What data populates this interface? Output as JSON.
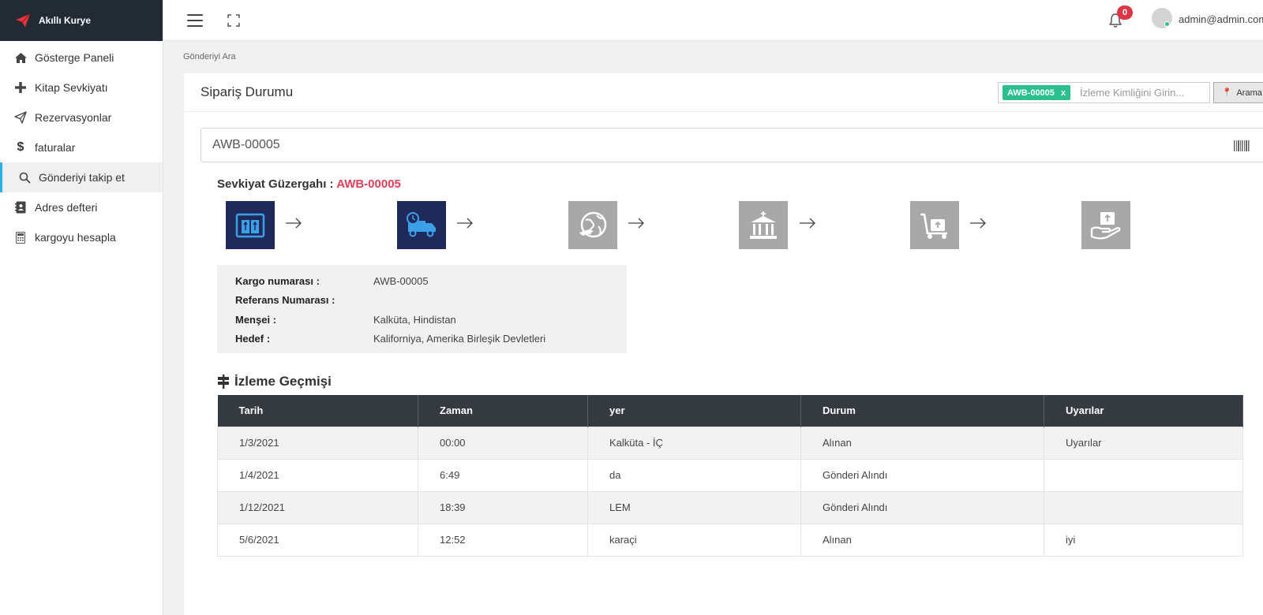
{
  "brand": {
    "name": "Akıllı Kurye",
    "logo_color": "#e8323c"
  },
  "sidebar": {
    "items": [
      {
        "label": "Gösterge Paneli",
        "icon": "home-icon"
      },
      {
        "label": "Kitap Sevkiyatı",
        "icon": "plus-icon"
      },
      {
        "label": "Rezervasyonlar",
        "icon": "paper-plane-icon"
      },
      {
        "label": "faturalar",
        "icon": "dollar-icon"
      },
      {
        "label": "Gönderiyi takip et",
        "icon": "search-icon",
        "active": true
      },
      {
        "label": "Adres defteri",
        "icon": "address-book-icon"
      },
      {
        "label": "kargoyu hesapla",
        "icon": "calculator-icon"
      }
    ]
  },
  "header": {
    "notification_count": "0",
    "user_email": "admin@admin.com"
  },
  "breadcrumb": "Gönderiyi Ara",
  "card": {
    "title": "Sipariş Durumu",
    "search": {
      "tag": "AWB-00005",
      "tag_remove": "x",
      "placeholder": "İzleme Kimliğini Girin...",
      "button_label": "Arama"
    },
    "awb_value": "AWB-00005"
  },
  "route": {
    "title": "Sevkiyat Güzergahı :",
    "awb": "AWB-00005",
    "steps": [
      {
        "icon": "warehouse-boxes-icon",
        "status": "done"
      },
      {
        "icon": "delivery-truck-icon",
        "status": "done"
      },
      {
        "icon": "globe-plane-icon",
        "status": "pending"
      },
      {
        "icon": "customs-building-icon",
        "status": "pending"
      },
      {
        "icon": "hand-trolley-icon",
        "status": "pending"
      },
      {
        "icon": "hand-package-icon",
        "status": "pending"
      }
    ]
  },
  "shipment_info": {
    "cargo_number_label": "Kargo numarası :",
    "cargo_number": "AWB-00005",
    "reference_label": "Referans Numarası :",
    "reference": "",
    "origin_label": "Menşei :",
    "origin": "Kalküta, Hindistan",
    "destination_label": "Hedef :",
    "destination": "Kaliforniya, Amerika Birleşik Devletleri"
  },
  "history": {
    "title": "İzleme Geçmişi",
    "columns": [
      "Tarih",
      "Zaman",
      "yer",
      "Durum",
      "Uyarılar"
    ],
    "rows": [
      [
        "1/3/2021",
        "00:00",
        "Kalküta - İÇ",
        "Alınan",
        "Uyarılar"
      ],
      [
        "1/4/2021",
        "6:49",
        "da",
        "Gönderi Alındı",
        ""
      ],
      [
        "1/12/2021",
        "18:39",
        "LEM",
        "Gönderi Alındı",
        ""
      ],
      [
        "5/6/2021",
        "12:52",
        "karaçi",
        "Alınan",
        "iyi"
      ]
    ]
  },
  "colors": {
    "brand_bg": "#222b33",
    "active_accent": "#2bb0e8",
    "tag_green": "#2bbf8f",
    "awb_red": "#e0405a",
    "step_done": "#1f2a5a",
    "step_pending": "#a8a8a8",
    "table_header": "#343a40",
    "badge_red": "#dc3545"
  }
}
